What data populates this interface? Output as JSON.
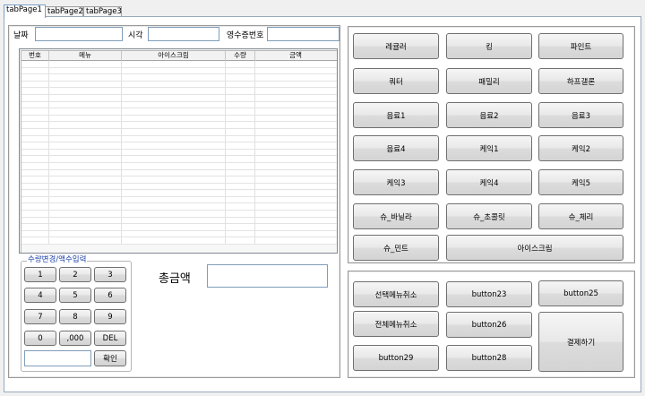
{
  "tabs": [
    {
      "label": "tabPage1",
      "active": true
    },
    {
      "label": "tabPage2",
      "active": false
    },
    {
      "label": "tabPage3",
      "active": false
    }
  ],
  "form": {
    "date_label": "날짜",
    "time_label": "시각",
    "receipt_label": "영수증번호",
    "date_value": "",
    "time_value": "",
    "receipt_value": ""
  },
  "grid": {
    "columns": [
      "번호",
      "메뉴",
      "아이스크림",
      "수량",
      "금액"
    ],
    "rows": []
  },
  "keypad": {
    "title": "수량변경/액수입력",
    "keys": [
      "1",
      "2",
      "3",
      "4",
      "5",
      "6",
      "7",
      "8",
      "9",
      "0",
      ",000",
      "DEL"
    ],
    "input_value": "",
    "confirm": "확인"
  },
  "total": {
    "label": "총금액",
    "value": ""
  },
  "menu_buttons": [
    "레귤러",
    "킹",
    "파인트",
    "쿼터",
    "패밀리",
    "하프갤론",
    "음료1",
    "음료2",
    "음료3",
    "음료4",
    "케익1",
    "케익2",
    "케익3",
    "케익4",
    "케익5",
    "슈_바닐라",
    "슈_초콜릿",
    "슈_체리",
    "슈_민트",
    "아이스크림"
  ],
  "action_buttons": {
    "cancel_selected": "선택메뉴취소",
    "button23": "button23",
    "button25": "button25",
    "cancel_all": "전체메뉴취소",
    "button26": "button26",
    "pay": "결제하기",
    "button29": "button29",
    "button28": "button28"
  }
}
